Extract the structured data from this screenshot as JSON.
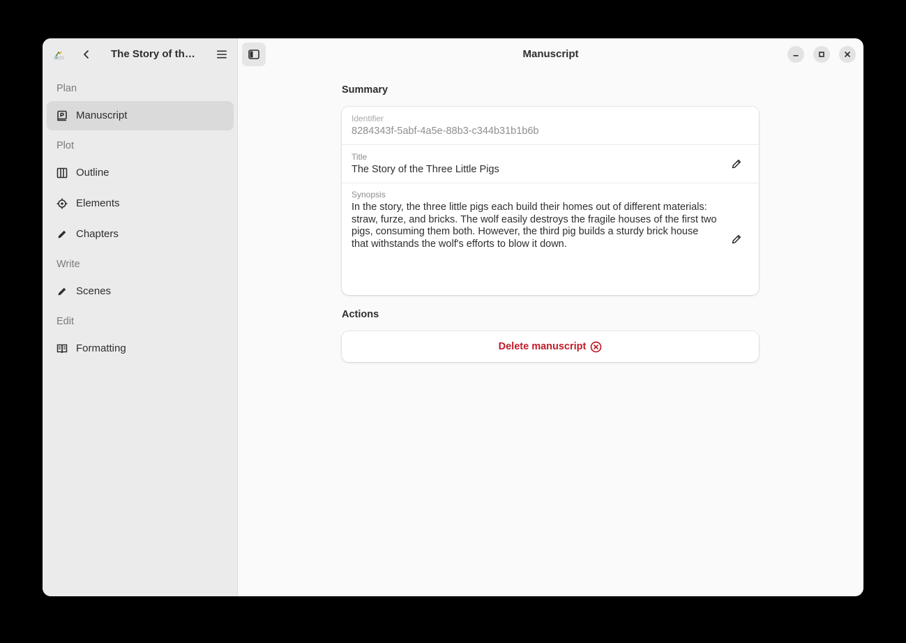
{
  "sidebar": {
    "title": "The Story of the Three Little Pigs",
    "sections": [
      {
        "label": "Plan",
        "items": [
          {
            "label": "Manuscript",
            "icon": "manuscript-icon",
            "active": true
          }
        ]
      },
      {
        "label": "Plot",
        "items": [
          {
            "label": "Outline",
            "icon": "columns-icon"
          },
          {
            "label": "Elements",
            "icon": "crosshair-icon"
          },
          {
            "label": "Chapters",
            "icon": "pencil-icon"
          }
        ]
      },
      {
        "label": "Write",
        "items": [
          {
            "label": "Scenes",
            "icon": "pencil-icon"
          }
        ]
      },
      {
        "label": "Edit",
        "items": [
          {
            "label": "Formatting",
            "icon": "book-open-icon"
          }
        ]
      }
    ]
  },
  "header": {
    "title": "Manuscript"
  },
  "summary": {
    "heading": "Summary",
    "identifier_label": "Identifier",
    "identifier_value": "8284343f-5abf-4a5e-88b3-c344b31b1b6b",
    "title_label": "Title",
    "title_value": "The Story of the Three Little Pigs",
    "synopsis_label": "Synopsis",
    "synopsis_value": "In the story, the three little pigs each build their homes out of different materials: straw, furze, and bricks. The wolf easily destroys the fragile houses of the first two pigs, consuming them both. However, the third pig builds a sturdy brick house that withstands the wolf's efforts to blow it down."
  },
  "actions": {
    "heading": "Actions",
    "delete_label": "Delete manuscript"
  },
  "colors": {
    "destructive": "#c01c28",
    "sidebar_bg": "#ebebeb",
    "window_bg": "#fafafa"
  }
}
